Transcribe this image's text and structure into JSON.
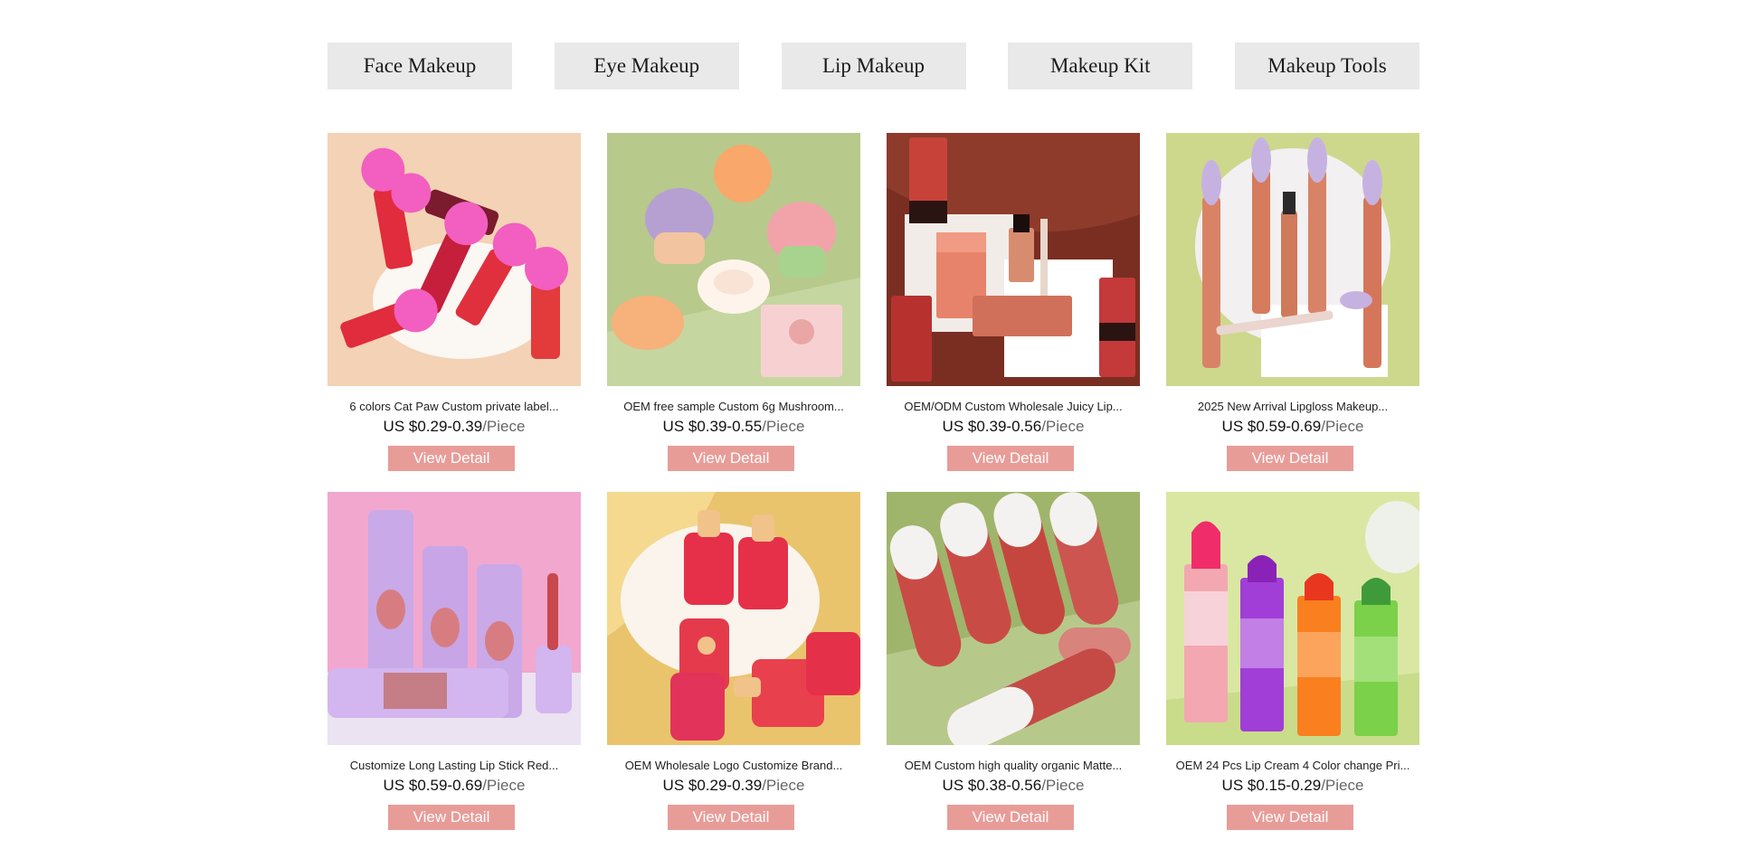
{
  "category_tabs": [
    {
      "label": "Face Makeup"
    },
    {
      "label": "Eye Makeup"
    },
    {
      "label": "Lip Makeup"
    },
    {
      "label": "Makeup Kit"
    },
    {
      "label": "Makeup Tools"
    }
  ],
  "products": [
    {
      "title": "6 colors Cat Paw Custom private label...",
      "price": "US $0.29-0.39",
      "unit": "/Piece",
      "button": "View Detail",
      "image": "cat-paw-lip-gloss-photo",
      "bg": "#f3d2b5"
    },
    {
      "title": "OEM free sample Custom 6g Mushroom...",
      "price": "US $0.39-0.55",
      "unit": "/Piece",
      "button": "View Detail",
      "image": "mushroom-lip-balm-photo",
      "bg": "#b8c98c"
    },
    {
      "title": "OEM/ODM Custom Wholesale Juicy Lip...",
      "price": "US $0.39-0.56",
      "unit": "/Piece",
      "button": "View Detail",
      "image": "chocolate-lip-gloss-photo",
      "bg": "#7a2e22"
    },
    {
      "title": "2025 New Arrival Lipgloss Makeup...",
      "price": "US $0.59-0.69",
      "unit": "/Piece",
      "button": "View Detail",
      "image": "matte-lipgloss-photo",
      "bg": "#cdd88d"
    },
    {
      "title": "Customize Long Lasting Lip Stick Red...",
      "price": "US $0.59-0.69",
      "unit": "/Piece",
      "button": "View Detail",
      "image": "lavender-lipstick-photo",
      "bg": "#f2a7cf"
    },
    {
      "title": "OEM Wholesale Logo Customize Brand...",
      "price": "US $0.29-0.39",
      "unit": "/Piece",
      "button": "View Detail",
      "image": "popsicle-lip-gloss-photo",
      "bg": "#e9c46d"
    },
    {
      "title": "OEM Custom high quality organic Matte...",
      "price": "US $0.38-0.56",
      "unit": "/Piece",
      "button": "View Detail",
      "image": "super-stay-matte-ink-photo",
      "bg": "#9fb56b"
    },
    {
      "title": "OEM 24 Pcs Lip Cream 4 Color change Pri...",
      "price": "US $0.15-0.29",
      "unit": "/Piece",
      "button": "View Detail",
      "image": "color-change-lipstick-photo",
      "bg": "#d9e7a3"
    }
  ],
  "colors": {
    "tab_bg": "#e9e9e9",
    "button_bg": "#e89c98",
    "button_text": "#ffffff"
  }
}
